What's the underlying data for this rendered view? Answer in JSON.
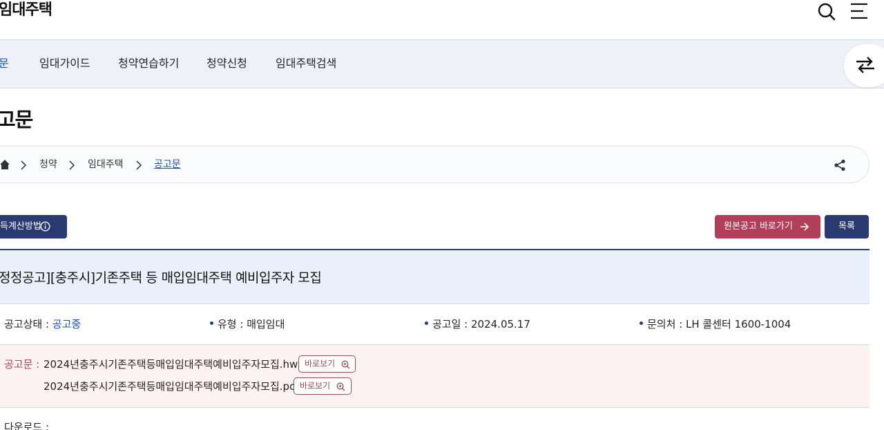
{
  "header": {
    "site_title": "임대주택"
  },
  "gnb": {
    "items": [
      {
        "label": "문",
        "active": true
      },
      {
        "label": "임대가이드",
        "active": false
      },
      {
        "label": "청약연습하기",
        "active": false
      },
      {
        "label": "청약신청",
        "active": false
      },
      {
        "label": "임대주택검색",
        "active": false
      }
    ]
  },
  "page": {
    "title": "고문"
  },
  "breadcrumb": {
    "items": [
      "청약",
      "임대주택",
      "공고문"
    ]
  },
  "actions": {
    "calc_label": "득계산방법",
    "original_label": "원본공고 바로가기",
    "list_label": "목록"
  },
  "notice": {
    "title": "정정공고][충주시]기존주택 등 매입임대주택 예비입주자 모집",
    "status_label": "공고상태 : ",
    "status_value": "공고중",
    "type_label": "유형 : ",
    "type_value": "매입임대",
    "date_label": "공고일 : ",
    "date_value": "2024.05.17",
    "contact_label": "문의처 : ",
    "contact_value": "LH 콜센터 1600-1004"
  },
  "files": {
    "label": "공고문 :",
    "view_label": "바로보기",
    "items": [
      {
        "name": "2024년충주시기존주택등매입임대주택예비입주자모집.hwp"
      },
      {
        "name": "2024년충주시기존주택등매입임대주택예비입주자모집.pdf"
      }
    ]
  },
  "download": {
    "label": "다운로드 :"
  },
  "colors": {
    "navy": "#2a3a70",
    "accent_red": "#b23f5a",
    "link_blue": "#1c4ea8",
    "nav_bg": "#eef2f8"
  }
}
